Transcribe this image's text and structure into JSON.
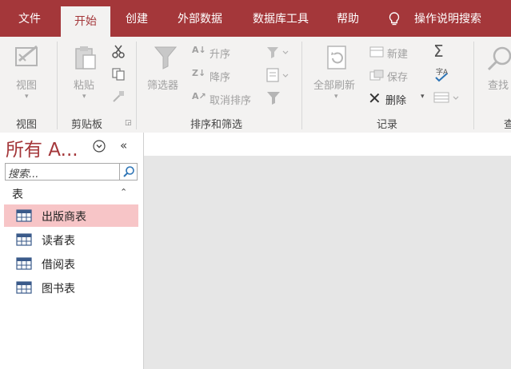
{
  "tabs": [
    {
      "label": "文件"
    },
    {
      "label": "开始"
    },
    {
      "label": "创建"
    },
    {
      "label": "外部数据"
    },
    {
      "label": "数据库工具"
    },
    {
      "label": "帮助"
    },
    {
      "label": "操作说明搜索"
    }
  ],
  "ribbon": {
    "view": {
      "button": "视图",
      "group": "视图"
    },
    "clipboard": {
      "paste": "粘贴",
      "group": "剪贴板"
    },
    "sort_filter": {
      "filter": "筛选器",
      "ascending": "升序",
      "descending": "降序",
      "clear_sort": "取消排序",
      "group": "排序和筛选"
    },
    "records": {
      "refresh_all": "全部刷新",
      "new": "新建",
      "save": "保存",
      "delete": "删除",
      "group": "记录"
    },
    "find": {
      "button": "查找",
      "group": "查"
    }
  },
  "nav": {
    "title": "所有 A...",
    "search_placeholder": "搜索...",
    "category": "表",
    "items": [
      {
        "label": "出版商表",
        "selected": true
      },
      {
        "label": "读者表",
        "selected": false
      },
      {
        "label": "借阅表",
        "selected": false
      },
      {
        "label": "图书表",
        "selected": false
      }
    ]
  },
  "colors": {
    "accent": "#a4373a",
    "ribbon_bg": "#f3f2f1",
    "selection": "#f7c5c7",
    "workspace": "#e6e6e6"
  }
}
